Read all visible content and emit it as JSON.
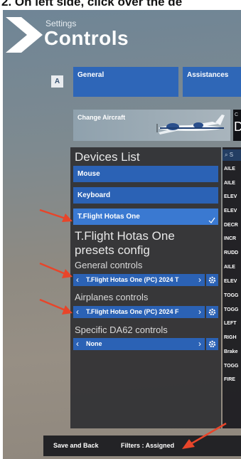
{
  "caption": {
    "text": "2. On left side, click over the de"
  },
  "header": {
    "subtitle": "Settings",
    "title": "Controls"
  },
  "tabs": {
    "key_hint": "A",
    "general": "General",
    "assistances": "Assistances"
  },
  "aircraft": {
    "button": "Change Aircraft",
    "side_c": "C",
    "side_d": "D"
  },
  "devices": {
    "title": "Devices List",
    "items": [
      {
        "label": "Mouse"
      },
      {
        "label": "Keyboard"
      },
      {
        "label": "T.Flight Hotas One"
      }
    ],
    "selected_index": 2
  },
  "presets": {
    "title_line1": "T.Flight Hotas One",
    "title_line2": "presets config",
    "general": {
      "label": "General controls",
      "value": "T.Flight Hotas One (PC) 2024 T"
    },
    "airplanes": {
      "label": "Airplanes controls",
      "value": "T.Flight Hotas One (PC) 2024 F"
    },
    "specific": {
      "label": "Specific DA62 controls",
      "value": "None"
    }
  },
  "bindings": {
    "search_text": "S",
    "items": [
      "AILE",
      "AILE",
      "ELEV",
      "ELEV",
      "DECR",
      "INCR",
      "RUDD",
      "AILE",
      "ELEV",
      "TOGG",
      "TOGG",
      "LEFT",
      "RIGH",
      "Brake",
      "TOGG",
      "FIRE"
    ]
  },
  "footer": {
    "save": "Save and Back",
    "filters": "Filters : Assigned"
  },
  "colors": {
    "accent": "#2b62b5",
    "selected": "#3a79d1",
    "annotation_arrow": "#e8452a",
    "panel": "#303034"
  }
}
